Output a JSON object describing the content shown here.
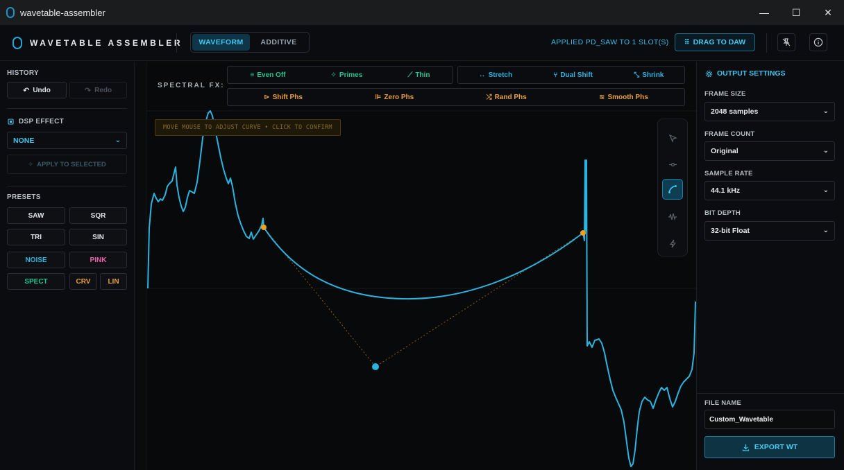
{
  "window": {
    "title": "wavetable-assembler",
    "minimize": "—",
    "maximize": "☐",
    "close": "✕"
  },
  "header": {
    "brand": "WAVETABLE ASSEMBLER",
    "tabs": [
      {
        "label": "WAVEFORM",
        "active": true
      },
      {
        "label": "ADDITIVE",
        "active": false
      }
    ],
    "status": "APPLIED PD_SAW TO 1 SLOT(S)",
    "drag_label": "DRAG TO DAW"
  },
  "left": {
    "history_title": "HISTORY",
    "undo": "Undo",
    "redo": "Redo",
    "dsp_title": "DSP EFFECT",
    "dsp_value": "NONE",
    "apply_label": "APPLY TO SELECTED",
    "presets_title": "PRESETS",
    "presets": [
      "SAW",
      "SQR",
      "TRI",
      "SIN",
      "NOISE",
      "PINK",
      "SPECT",
      "CRV",
      "LIN"
    ]
  },
  "canvas": {
    "fx_label": "SPECTRAL FX:",
    "fx_row1a": [
      "Even Off",
      "Primes",
      "Thin"
    ],
    "fx_row1b": [
      "Stretch",
      "Dual Shift",
      "Shrink"
    ],
    "fx_row2": [
      "Shift Phs",
      "Zero Phs",
      "Rand Phs",
      "Smooth Phs"
    ],
    "hint": "MOVE MOUSE TO ADJUST CURVE • CLICK TO CONFIRM",
    "tools": [
      "pointer-icon",
      "node-icon",
      "curve-icon",
      "noise-icon",
      "bolt-icon"
    ],
    "active_tool": "curve-icon"
  },
  "right": {
    "title": "OUTPUT SETTINGS",
    "frame_size_label": "FRAME SIZE",
    "frame_size": "2048 samples",
    "frame_count_label": "FRAME COUNT",
    "frame_count": "Original",
    "sample_rate_label": "SAMPLE RATE",
    "sample_rate": "44.1 kHz",
    "bit_depth_label": "BIT DEPTH",
    "bit_depth": "32-bit Float",
    "file_name_label": "FILE NAME",
    "file_name": "Custom_Wavetable",
    "export_label": "EXPORT WT"
  },
  "colors": {
    "accent": "#2ab4e0",
    "green": "#22c58b",
    "orange": "#e8a03a",
    "pink": "#f05fa8",
    "anchor": "#f0a21e"
  }
}
